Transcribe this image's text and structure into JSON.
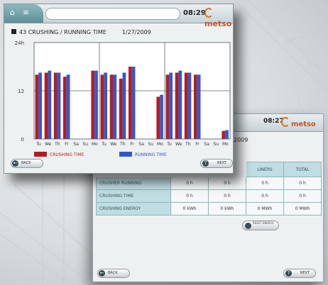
{
  "back_screen": {
    "time": "08:27",
    "brand": "metso",
    "date_fragment": "2009",
    "table": {
      "headers": [
        "",
        "",
        "",
        "LINERS",
        "TOTAL"
      ],
      "rows": [
        {
          "label": "CRUSHER RUNNING",
          "values": [
            "0 h",
            "0 h",
            "0 h",
            "0 h"
          ]
        },
        {
          "label": "CRUSHING TIME",
          "values": [
            "0 h",
            "0 h",
            "0 h",
            "0 h"
          ]
        },
        {
          "label": "CRUSHING ENERGY",
          "values": [
            "0 kWh",
            "0 kWh",
            "0 MWh",
            "0 MWh"
          ]
        }
      ]
    },
    "reset_label": "RESET ENERGY",
    "back_label": "BACK",
    "next_label": "NEXT"
  },
  "front_screen": {
    "time": "08:29",
    "brand": "metso",
    "title": "43 CRUSHING / RUNNING TIME",
    "date": "1/27/2009",
    "back_label": "BACK",
    "next_label": "NEXT",
    "icons": {
      "home": "home-icon",
      "network": "network-icon",
      "brand": "metso-logo-icon",
      "back": "back-arrow-icon",
      "next": "help-icon"
    }
  },
  "chart_data": {
    "type": "bar",
    "title": "43 CRUSHING / RUNNING TIME",
    "categories": [
      "Tu",
      "We",
      "Th",
      "Fr",
      "Sa",
      "Su",
      "Mo",
      "Tu",
      "We",
      "Th",
      "Fr",
      "Sa",
      "Su",
      "Mo",
      "Tu",
      "We",
      "Th",
      "Fr",
      "Sa",
      "Su",
      "Mo"
    ],
    "series": [
      {
        "name": "CRUSHING TIME",
        "color": "#b01e23",
        "values": [
          16,
          16.5,
          16.5,
          15.5,
          0,
          0,
          17,
          16,
          16,
          15,
          18,
          0,
          0,
          10.5,
          16,
          16.5,
          16.5,
          16,
          0,
          0,
          2
        ]
      },
      {
        "name": "RUNNING TIME",
        "color": "#3558c7",
        "values": [
          16.5,
          17,
          16.5,
          16,
          0,
          0,
          17,
          16.5,
          16,
          16.5,
          18,
          0,
          0,
          11,
          16.5,
          17,
          16.5,
          16,
          0,
          0,
          2.2
        ]
      }
    ],
    "y_ticks": [
      "0",
      "12",
      "24h"
    ],
    "ylim": [
      0,
      24
    ],
    "grid": true,
    "legend": "bottom-left"
  }
}
